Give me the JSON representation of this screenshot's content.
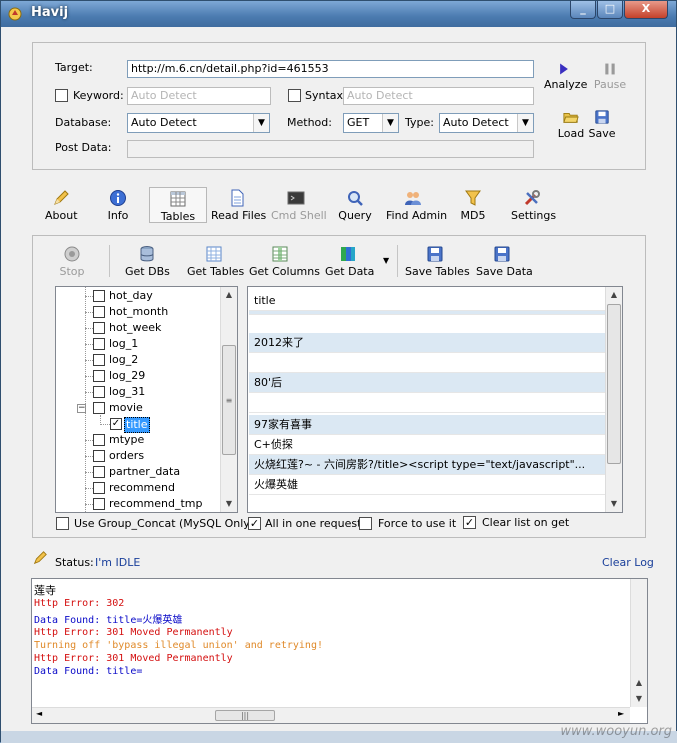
{
  "window": {
    "title": "Havij"
  },
  "target_section": {
    "target_label": "Target:",
    "target_value": "http://m.6.cn/detail.php?id=461553",
    "keyword_label": "Keyword:",
    "keyword_placeholder": "Auto Detect",
    "syntax_label": "Syntax:",
    "syntax_placeholder": "Auto Detect",
    "database_label": "Database:",
    "database_value": "Auto Detect",
    "method_label": "Method:",
    "method_value": "GET",
    "type_label": "Type:",
    "type_value": "Auto Detect",
    "postdata_label": "Post Data:",
    "postdata_value": "",
    "analyze_label": "Analyze",
    "pause_label": "Pause",
    "load_label": "Load",
    "save_label": "Save"
  },
  "main_toolbar": [
    {
      "label": "About",
      "icon": "pencil-icon"
    },
    {
      "label": "Info",
      "icon": "info-icon"
    },
    {
      "label": "Tables",
      "icon": "tables-icon",
      "active": true
    },
    {
      "label": "Read Files",
      "icon": "file-icon"
    },
    {
      "label": "Cmd Shell",
      "icon": "console-icon",
      "disabled": true
    },
    {
      "label": "Query",
      "icon": "query-icon"
    },
    {
      "label": "Find Admin",
      "icon": "users-icon"
    },
    {
      "label": "MD5",
      "icon": "funnel-icon"
    },
    {
      "label": "Settings",
      "icon": "tools-icon"
    }
  ],
  "tables_toolbar": {
    "stop": "Stop",
    "get_dbs": "Get DBs",
    "get_tables": "Get Tables",
    "get_columns": "Get Columns",
    "get_data": "Get Data",
    "save_tables": "Save Tables",
    "save_data": "Save Data"
  },
  "tree": [
    {
      "label": "hot_day"
    },
    {
      "label": "hot_month"
    },
    {
      "label": "hot_week"
    },
    {
      "label": "log_1"
    },
    {
      "label": "log_2"
    },
    {
      "label": "log_29"
    },
    {
      "label": "log_31"
    },
    {
      "label": "movie",
      "expanded": true
    },
    {
      "label": "title",
      "checked": true,
      "selected": true
    },
    {
      "label": "mtype"
    },
    {
      "label": "orders"
    },
    {
      "label": "partner_data"
    },
    {
      "label": "recommend"
    },
    {
      "label": "recommend_tmp"
    }
  ],
  "grid": {
    "rows": [
      "title",
      "",
      "2012来了",
      "",
      "80'后",
      "",
      "97家有喜事",
      "C+侦探",
      "火烧红莲?~ - 六间房影?/title><script type=\"text/javascript\"...",
      "火爆英雄"
    ]
  },
  "options": {
    "group_concat": "Use Group_Concat (MySQL Only)",
    "all_in_one": "All in one request.",
    "force_use": "Force to use it",
    "clear_list": "Clear list on get"
  },
  "status": {
    "label": "Status:",
    "value": "I'm IDLE",
    "clear_log": "Clear Log"
  },
  "log": [
    {
      "text": "莲寺",
      "color": "black"
    },
    {
      "text": "Http Error: 302",
      "color": "red"
    },
    {
      "text": "Data Found: title=火爆英雄",
      "color": "blue"
    },
    {
      "text": "Http Error: 301 Moved Permanently",
      "color": "red"
    },
    {
      "text": "Turning off 'bypass illegal union' and retrying!",
      "color": "orange"
    },
    {
      "text": "Http Error: 301 Moved Permanently",
      "color": "red"
    },
    {
      "text": "Data Found: title=",
      "color": "blue"
    }
  ],
  "watermark": "www.wooyun.org"
}
